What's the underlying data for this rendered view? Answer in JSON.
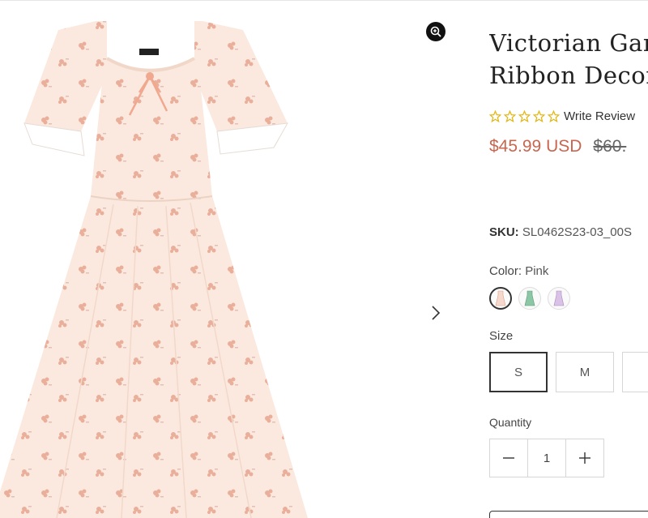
{
  "product": {
    "title_line1": "Victorian Garden",
    "title_line2": "Ribbon Decor",
    "write_review": "Write Review",
    "rating": 0,
    "price": "$45.99 USD",
    "original_price": "$60.",
    "sku_label": "SKU:",
    "sku_value": "SL0462S23-03_00S",
    "color_label": "Color:",
    "color_value": "Pink",
    "size_label": "Size",
    "sizes": [
      "S",
      "M",
      ""
    ],
    "selected_size": "S",
    "quantity_label": "Quantity",
    "quantity_value": "1"
  },
  "colors": {
    "accent_price": "#c9664f",
    "star_gold": "#e2b714",
    "swatch_pink": "#f6d9cc",
    "swatch_green": "#8cc7a5",
    "swatch_lavender": "#d9c2e6"
  }
}
